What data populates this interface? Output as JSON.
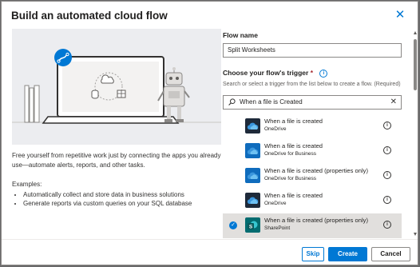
{
  "dialog": {
    "title": "Build an automated cloud flow",
    "close_icon": "close-icon"
  },
  "left": {
    "description": "Free yourself from repetitive work just by connecting the apps you already use—automate alerts, reports, and other tasks.",
    "examples_label": "Examples:",
    "examples": [
      "Automatically collect and store data in business solutions",
      "Generate reports via custom queries on your SQL database"
    ]
  },
  "form": {
    "flow_name_label": "Flow name",
    "flow_name_value": "Split Worksheets",
    "trigger_label": "Choose your flow's trigger",
    "required_mark": "*",
    "help_text": "Search or select a trigger from the list below to create a flow. (Required)",
    "search_value": "When a file is Created"
  },
  "triggers": [
    {
      "name": "When a file is created",
      "connector": "OneDrive",
      "tile_color": "#1e2a3a",
      "icon": "onedrive-icon",
      "selected": false
    },
    {
      "name": "When a file is created",
      "connector": "OneDrive for Business",
      "tile_color": "#0f6cbd",
      "icon": "onedrive-for-business-icon",
      "selected": false
    },
    {
      "name": "When a file is created (properties only)",
      "connector": "OneDrive for Business",
      "tile_color": "#0f6cbd",
      "icon": "onedrive-for-business-icon",
      "selected": false
    },
    {
      "name": "When a file is created",
      "connector": "OneDrive",
      "tile_color": "#1e2a3a",
      "icon": "onedrive-icon",
      "selected": false
    },
    {
      "name": "When a file is created (properties only)",
      "connector": "SharePoint",
      "tile_color": "#036c70",
      "icon": "sharepoint-icon",
      "selected": true
    }
  ],
  "buttons": {
    "skip": "Skip",
    "create": "Create",
    "cancel": "Cancel"
  },
  "colors": {
    "accent": "#0078d4",
    "selected_row": "#e1dfdd"
  }
}
